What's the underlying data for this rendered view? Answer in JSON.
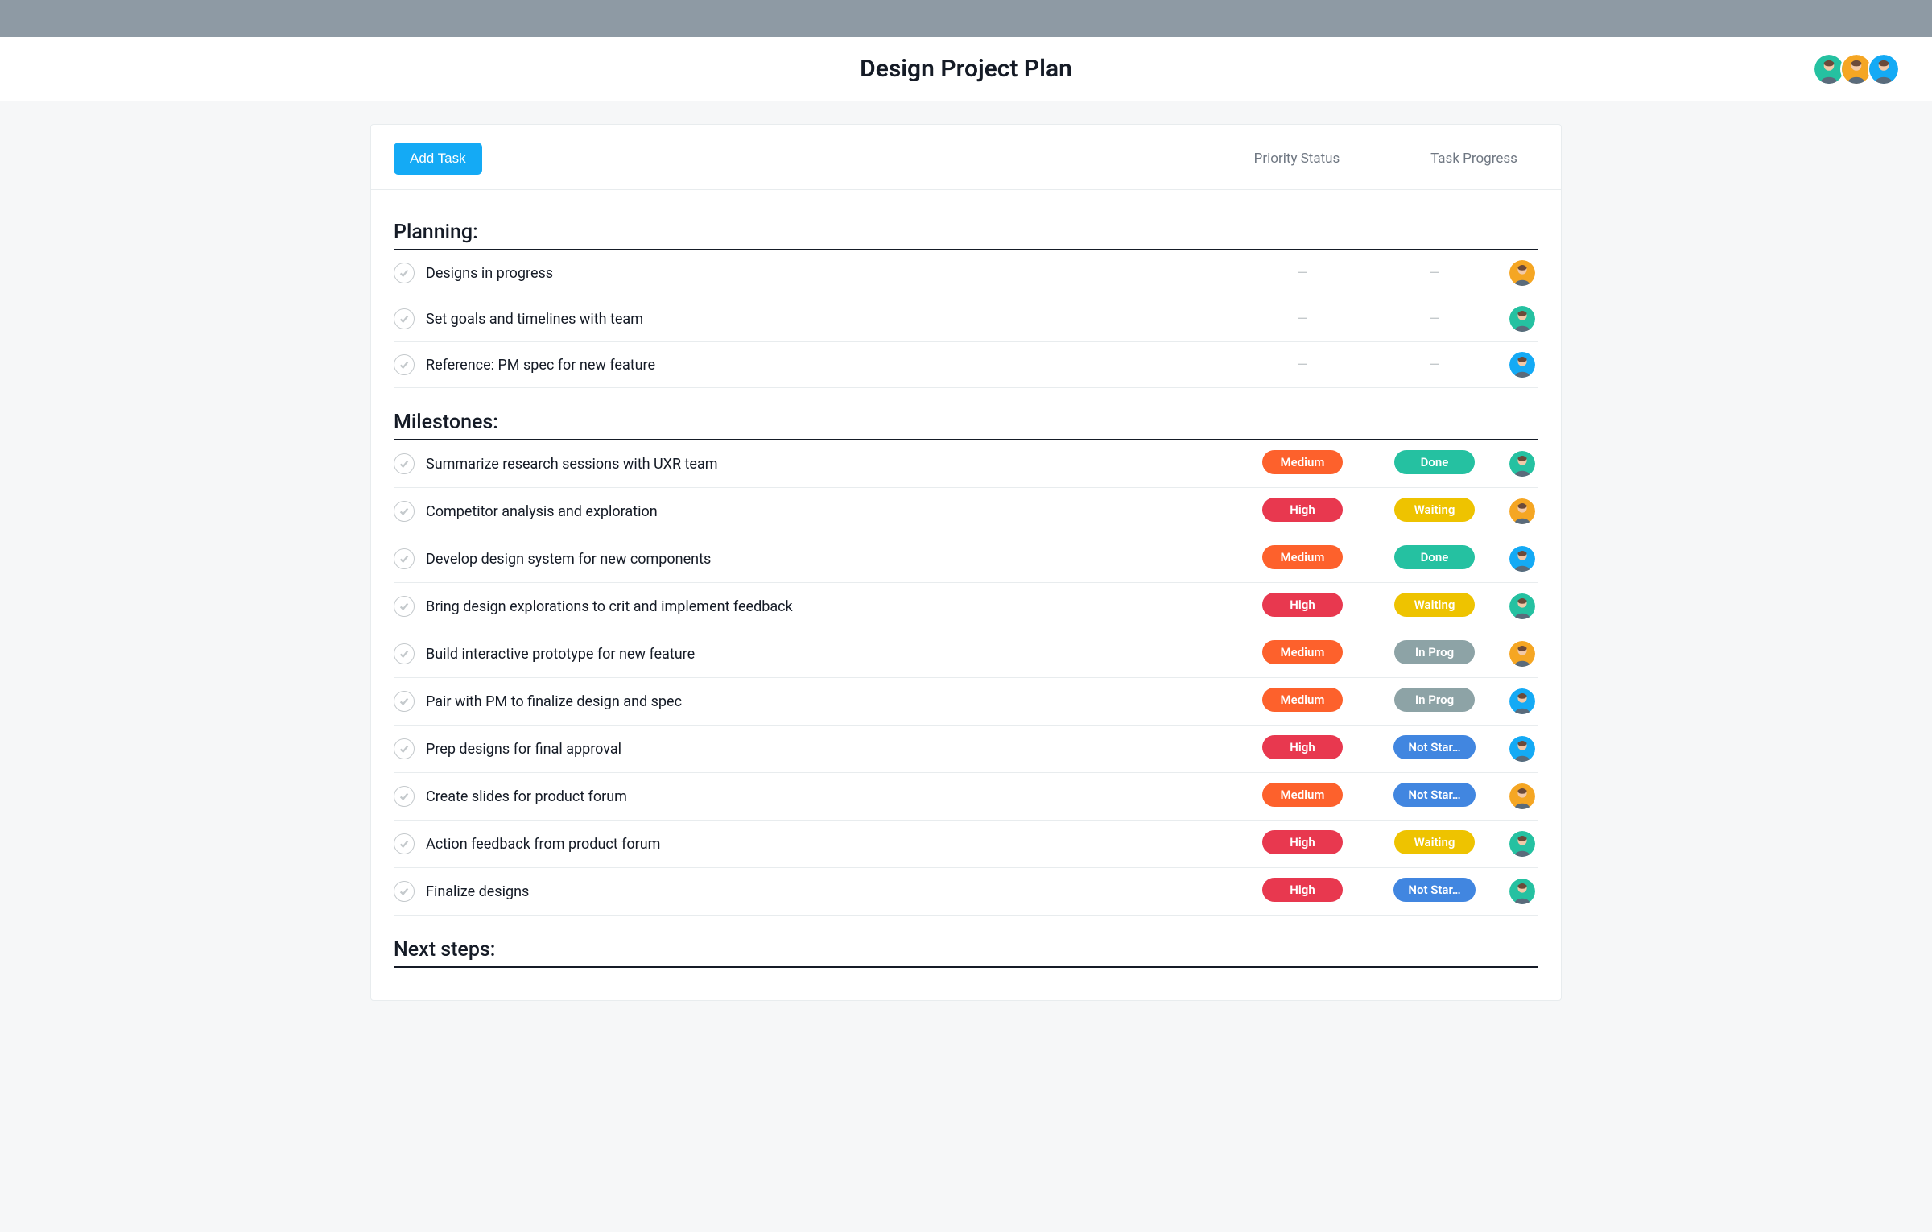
{
  "header": {
    "title": "Design Project Plan",
    "avatars": [
      "green",
      "yellow",
      "cyan"
    ]
  },
  "toolbar": {
    "add_task_label": "Add Task",
    "columns": {
      "priority": "Priority Status",
      "progress": "Task Progress"
    }
  },
  "priority_labels": {
    "medium": "Medium",
    "high": "High"
  },
  "progress_labels": {
    "done": "Done",
    "waiting": "Waiting",
    "inprog": "In Prog",
    "notstart": "Not Star…"
  },
  "sections": [
    {
      "title": "Planning:",
      "tasks": [
        {
          "title": "Designs in progress",
          "priority": null,
          "progress": null,
          "assignee": "yellow"
        },
        {
          "title": "Set goals and timelines with team",
          "priority": null,
          "progress": null,
          "assignee": "green"
        },
        {
          "title": "Reference: PM spec for new feature",
          "priority": null,
          "progress": null,
          "assignee": "cyan"
        }
      ]
    },
    {
      "title": "Milestones:",
      "tasks": [
        {
          "title": "Summarize research sessions with UXR team",
          "priority": "medium",
          "progress": "done",
          "assignee": "green"
        },
        {
          "title": "Competitor analysis and exploration",
          "priority": "high",
          "progress": "waiting",
          "assignee": "yellow"
        },
        {
          "title": "Develop design system for new components",
          "priority": "medium",
          "progress": "done",
          "assignee": "cyan"
        },
        {
          "title": "Bring design explorations to crit and implement feedback",
          "priority": "high",
          "progress": "waiting",
          "assignee": "green"
        },
        {
          "title": "Build interactive prototype for new feature",
          "priority": "medium",
          "progress": "inprog",
          "assignee": "yellow"
        },
        {
          "title": "Pair with PM to finalize design and spec",
          "priority": "medium",
          "progress": "inprog",
          "assignee": "cyan"
        },
        {
          "title": "Prep designs for final approval",
          "priority": "high",
          "progress": "notstart",
          "assignee": "cyan"
        },
        {
          "title": "Create slides for product forum",
          "priority": "medium",
          "progress": "notstart",
          "assignee": "yellow"
        },
        {
          "title": "Action feedback from product forum",
          "priority": "high",
          "progress": "waiting",
          "assignee": "green"
        },
        {
          "title": "Finalize designs",
          "priority": "high",
          "progress": "notstart",
          "assignee": "green"
        }
      ]
    },
    {
      "title": "Next steps:",
      "tasks": []
    }
  ],
  "avatar_colors": {
    "green": "#25c1a1",
    "yellow": "#f5a623",
    "cyan": "#14aaf5"
  }
}
